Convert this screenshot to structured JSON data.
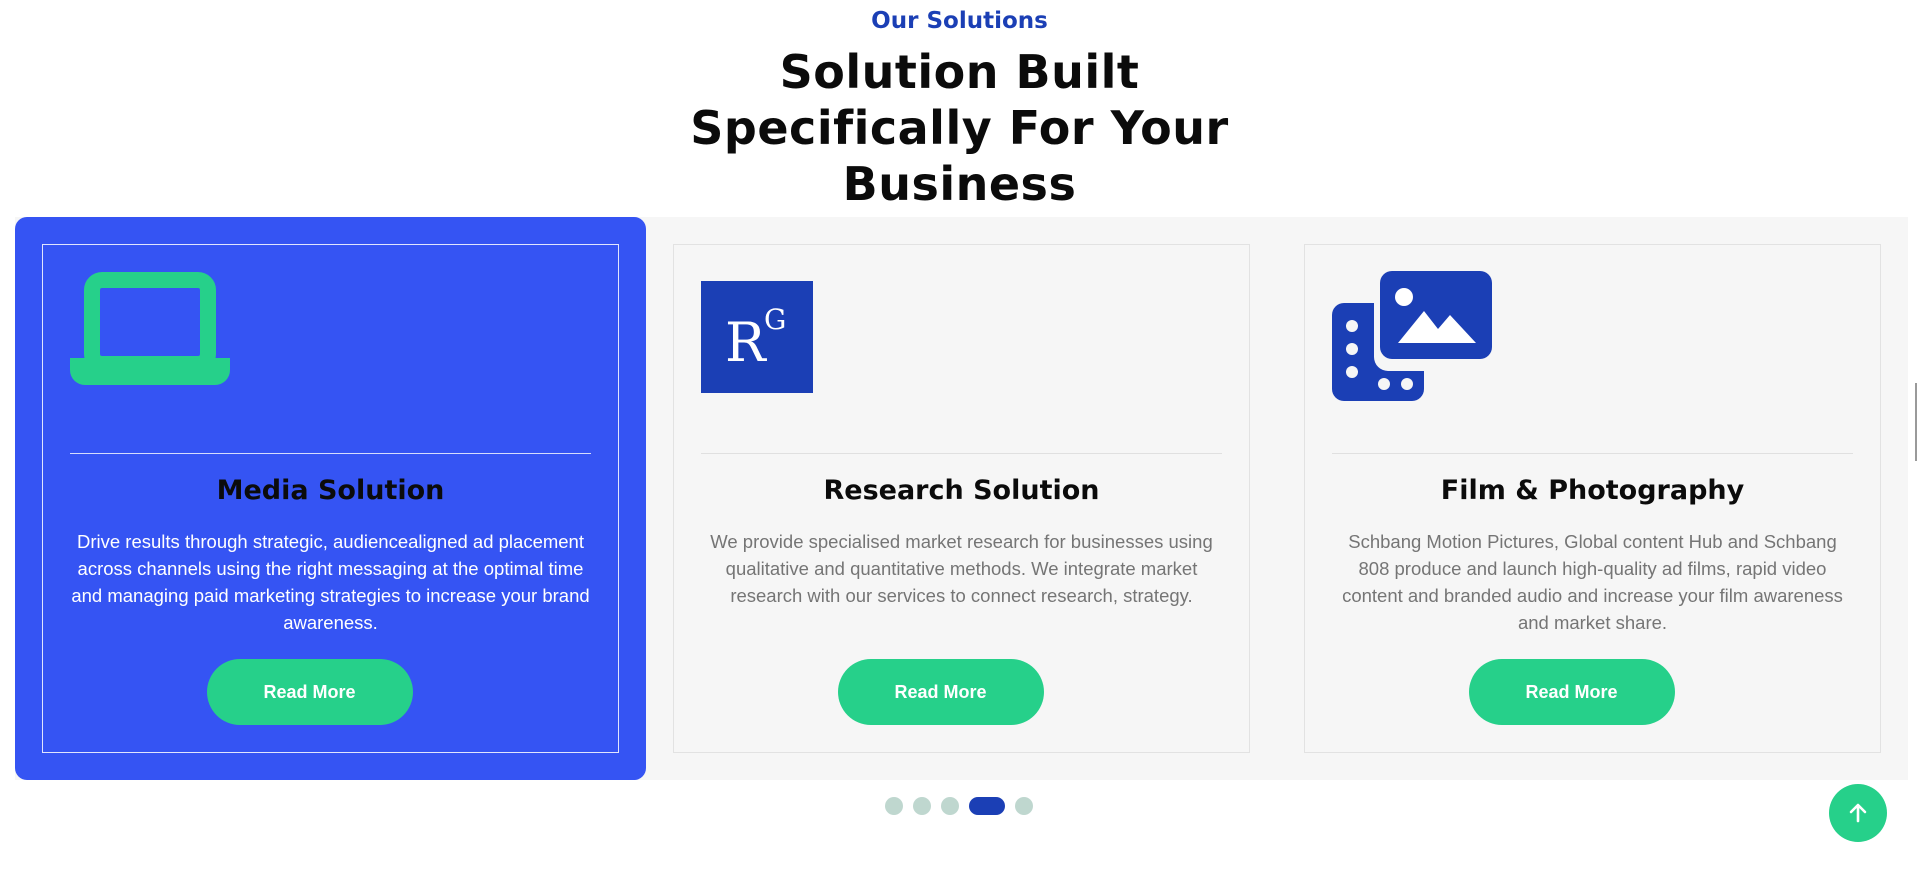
{
  "section": {
    "eyebrow": "Our Solutions",
    "heading": "Solution Built Specifically For Your Business"
  },
  "cards": [
    {
      "title": "Media Solution",
      "description": "Drive results through strategic, audiencealigned ad placement across channels using the right messaging at the optimal time and managing paid marketing strategies to increase your brand awareness.",
      "button": "Read More",
      "icon": "laptop-icon",
      "active": true
    },
    {
      "title": "Research Solution",
      "description": "We provide specialised market research for businesses using qualitative and quantitative methods. We integrate market research with our services to connect research, strategy.",
      "button": "Read More",
      "icon": "researchgate-logo",
      "logo_text": "RG"
    },
    {
      "title": "Film & Photography",
      "description": "Schbang Motion Pictures, Global content Hub and Schbang 808 produce and launch high-quality ad films, rapid video content and branded audio and increase your film awareness and market share.",
      "button": "Read More",
      "icon": "film-photo-icon"
    }
  ],
  "pagination": {
    "count": 5,
    "active_index": 3
  },
  "colors": {
    "accent_blue": "#3554f3",
    "dark_blue": "#1b3fb5",
    "green": "#26d08a",
    "dot_inactive": "#bfd7cf"
  },
  "scroll_to_top_icon": "arrow-up-icon"
}
